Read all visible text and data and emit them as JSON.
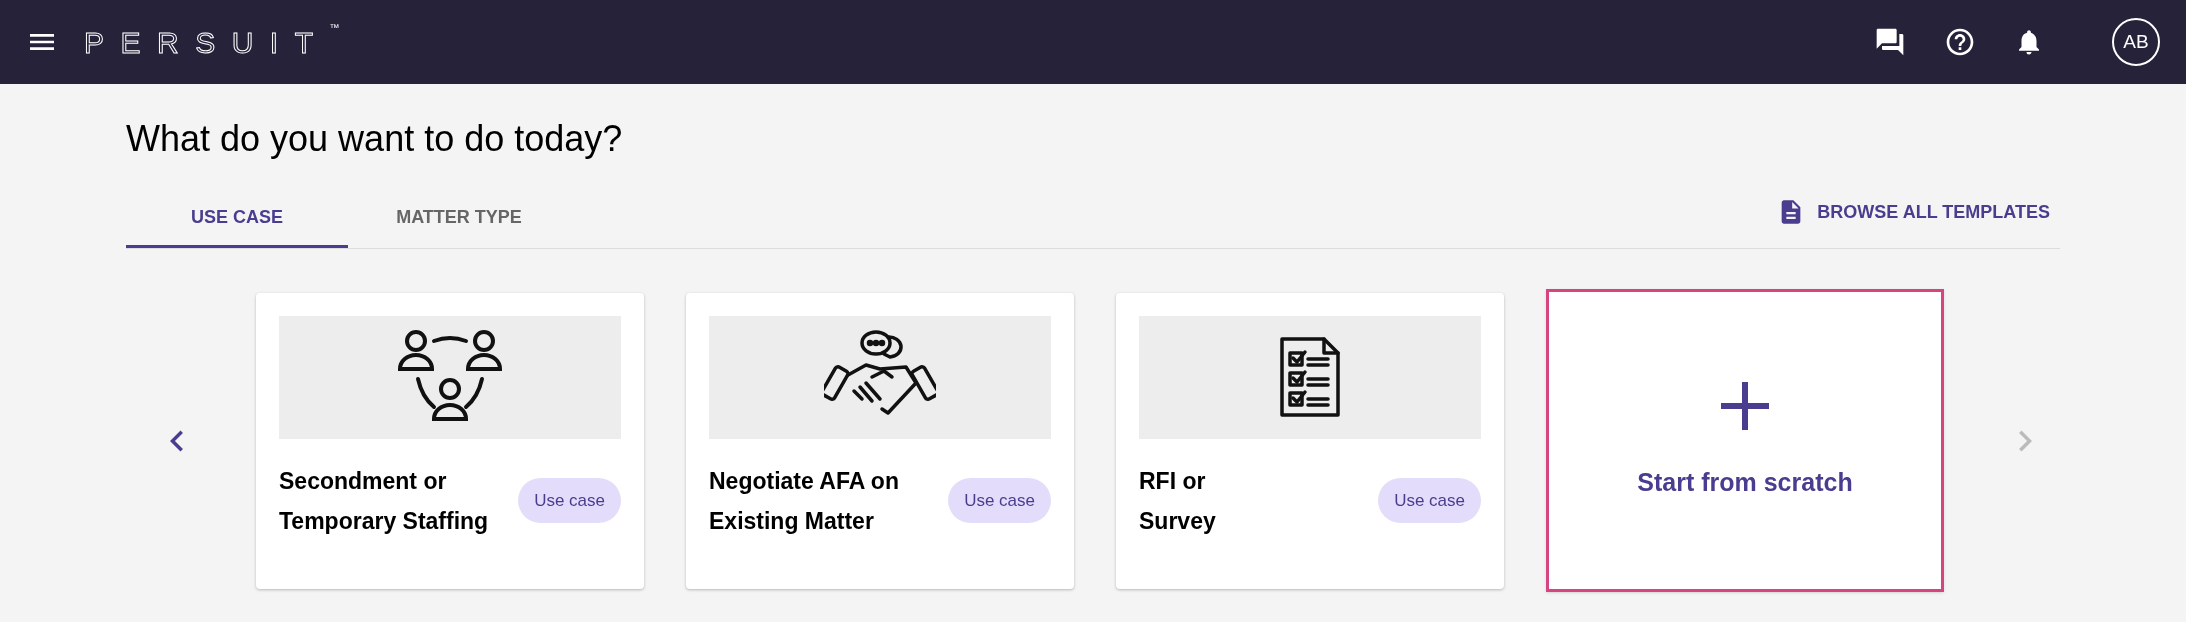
{
  "header": {
    "logo": "PERSUIT",
    "trademark": "™",
    "avatar": "AB"
  },
  "title": "What do you want to do today?",
  "tabs": [
    {
      "label": "USE CASE",
      "selected": true
    },
    {
      "label": "MATTER TYPE",
      "selected": false
    }
  ],
  "browse_link": "BROWSE ALL TEMPLATES",
  "carousel": {
    "prev_disabled": false,
    "next_disabled": true
  },
  "cards": [
    {
      "kind": "use_case",
      "title_lines": [
        "Secondment or",
        "Temporary Staffing"
      ],
      "badge": "Use case",
      "selected": false
    },
    {
      "kind": "use_case",
      "title_lines": [
        "Negotiate AFA on",
        "Existing Matter"
      ],
      "badge": "Use case",
      "selected": false
    },
    {
      "kind": "use_case",
      "title_lines": [
        "RFI or",
        "Survey"
      ],
      "badge": "Use case",
      "selected": false
    },
    {
      "kind": "scratch",
      "title": "Start from scratch",
      "selected": true
    }
  ]
}
